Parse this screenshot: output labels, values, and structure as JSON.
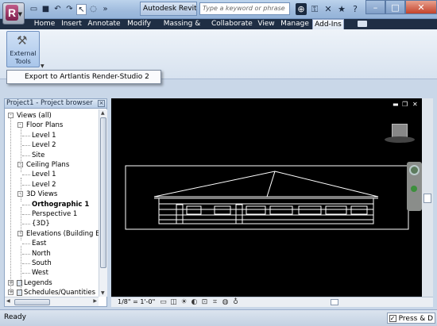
{
  "app": {
    "window_title": "Autodesk Revit ...",
    "search_placeholder": "Type a keyword or phrase"
  },
  "ribbon": {
    "tabs": [
      "Home",
      "Insert",
      "Annotate",
      "Modify",
      "Massing & Site",
      "Collaborate",
      "View",
      "Manage",
      "Add-Ins"
    ],
    "active_tab": "Add-Ins",
    "external_tools_label": "External Tools",
    "external_tools_line1": "External",
    "external_tools_line2": "Tools",
    "dropdown_item": "Export to Artlantis Render-Studio 2"
  },
  "browser": {
    "title": "Project1 - Project browser",
    "tree": [
      {
        "label": "Views (all)",
        "level": 0,
        "toggle": "-"
      },
      {
        "label": "Floor Plans",
        "level": 1,
        "toggle": "-"
      },
      {
        "label": "Level 1",
        "level": 2
      },
      {
        "label": "Level 2",
        "level": 2
      },
      {
        "label": "Site",
        "level": 2
      },
      {
        "label": "Ceiling Plans",
        "level": 1,
        "toggle": "-"
      },
      {
        "label": "Level 1",
        "level": 2
      },
      {
        "label": "Level 2",
        "level": 2
      },
      {
        "label": "3D Views",
        "level": 1,
        "toggle": "-"
      },
      {
        "label": "Orthographic 1",
        "level": 2,
        "bold": true
      },
      {
        "label": "Perspective 1",
        "level": 2
      },
      {
        "label": "{3D}",
        "level": 2
      },
      {
        "label": "Elevations (Building El",
        "level": 1,
        "toggle": "-"
      },
      {
        "label": "East",
        "level": 2
      },
      {
        "label": "North",
        "level": 2
      },
      {
        "label": "South",
        "level": 2
      },
      {
        "label": "West",
        "level": 2
      },
      {
        "label": "Legends",
        "level": 0,
        "toggle": "+"
      },
      {
        "label": "Schedules/Quantities",
        "level": 0,
        "toggle": "+"
      }
    ]
  },
  "view": {
    "scale": "1/8\" = 1'-0\""
  },
  "status": {
    "text": "Ready",
    "press_drag": "Press & D"
  }
}
